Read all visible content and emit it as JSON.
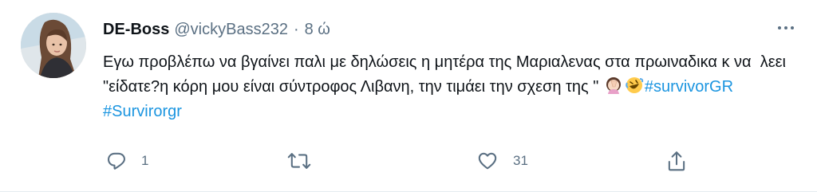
{
  "tweet": {
    "display_name": "DE-Boss",
    "handle": "@vickyBass232",
    "separator": "·",
    "time": "8 ώ",
    "text_part1": "Εγω προβλέπω να βγαίνει παλι με δηλώσεις η μητέρα της Μαριαλενας στα πρωιναδικα κ να  λεει \"είδατε?η κόρη μου είναι σύντροφος Λιβανη, την τιμάει την σχεση της \" ",
    "hashtags": [
      "#survivorGR",
      "#Survirorgr"
    ],
    "emojis": [
      "woman-facepalming-emoji",
      "rolling-on-floor-laughing-emoji"
    ]
  },
  "actions": {
    "reply_count": "1",
    "retweet_count": "",
    "like_count": "31",
    "share_count": ""
  },
  "colors": {
    "text": "#0f1419",
    "secondary": "#5b7083",
    "link": "#1b95e0",
    "divider": "#e6ecf0"
  },
  "icons": [
    "reply-icon",
    "retweet-icon",
    "like-icon",
    "share-icon",
    "more-icon"
  ]
}
